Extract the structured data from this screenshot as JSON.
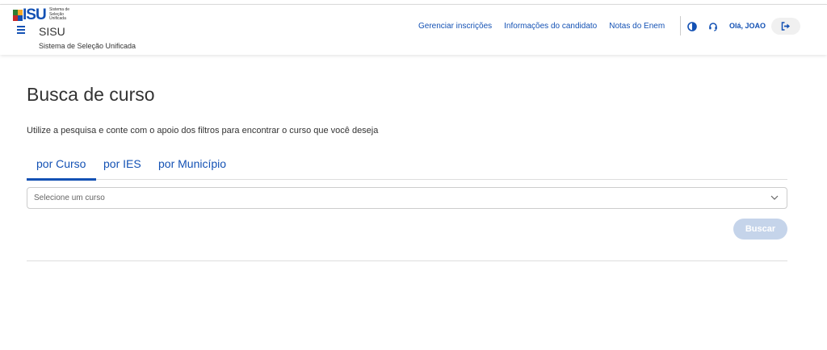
{
  "header": {
    "logo": {
      "text": "ISU",
      "subtitle_lines": [
        "Sistema de",
        "Seleção",
        "Unificada"
      ],
      "colors": [
        "#2e7d32",
        "#f9a825",
        "#c62828",
        "#1351b4"
      ]
    },
    "brand_name": "SISU",
    "brand_subtitle": "Sistema de Seleção Unificada",
    "nav_links": [
      {
        "label": "Gerenciar inscrições"
      },
      {
        "label": "Informações do candidato"
      },
      {
        "label": "Notas do Enem"
      }
    ],
    "icons": {
      "menu": "hamburger-menu-icon",
      "contrast": "contrast-icon",
      "support": "headset-icon",
      "logout": "sign-out-icon"
    },
    "greeting": "Olá, JOAO"
  },
  "main": {
    "title": "Busca de curso",
    "intro": "Utilize a pesquisa e conte com o apoio dos filtros para encontrar o curso que você deseja",
    "tabs": [
      {
        "label": "por Curso",
        "active": true
      },
      {
        "label": "por IES",
        "active": false
      },
      {
        "label": "por Município",
        "active": false
      }
    ],
    "select": {
      "placeholder": "Selecione um curso"
    },
    "search_button": "Buscar"
  },
  "colors": {
    "primary": "#1351b4",
    "button_disabled": "#c5d4ea"
  }
}
